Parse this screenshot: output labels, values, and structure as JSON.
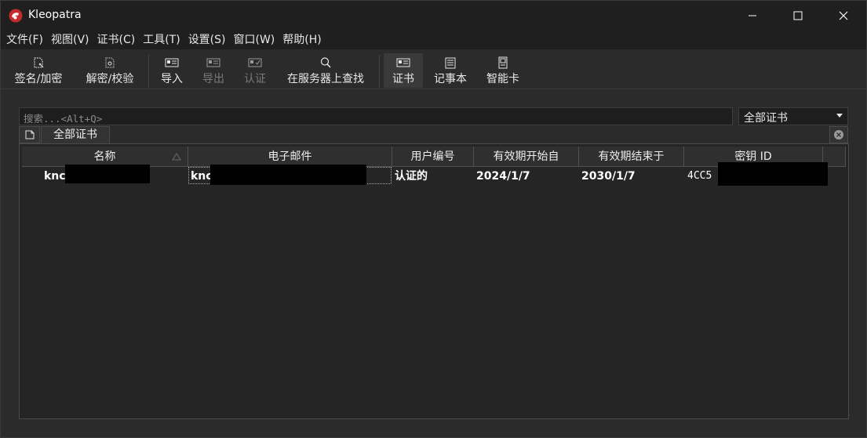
{
  "window": {
    "title": "Kleopatra"
  },
  "menu": [
    "文件(F)",
    "视图(V)",
    "证书(C)",
    "工具(T)",
    "设置(S)",
    "窗口(W)",
    "帮助(H)"
  ],
  "toolbar": {
    "sign_encrypt": "签名/加密",
    "decrypt_verify": "解密/校验",
    "import": "导入",
    "export": "导出",
    "certify": "认证",
    "lookup_server": "在服务器上查找",
    "certificates": "证书",
    "notepad": "记事本",
    "smartcards": "智能卡"
  },
  "search": {
    "placeholder": "搜索...<Alt+Q>"
  },
  "filter": {
    "selected": "全部证书"
  },
  "tabs": {
    "active": "全部证书"
  },
  "table": {
    "columns": [
      "名称",
      "电子邮件",
      "用户编号",
      "有效期开始自",
      "有效期结束于",
      "密钥 ID"
    ],
    "rows": [
      {
        "name": "knc",
        "email": "knc",
        "user_ids": "认证的",
        "valid_from": "2024/1/7",
        "valid_until": "2030/1/7",
        "key_id": "4CC5"
      }
    ]
  }
}
